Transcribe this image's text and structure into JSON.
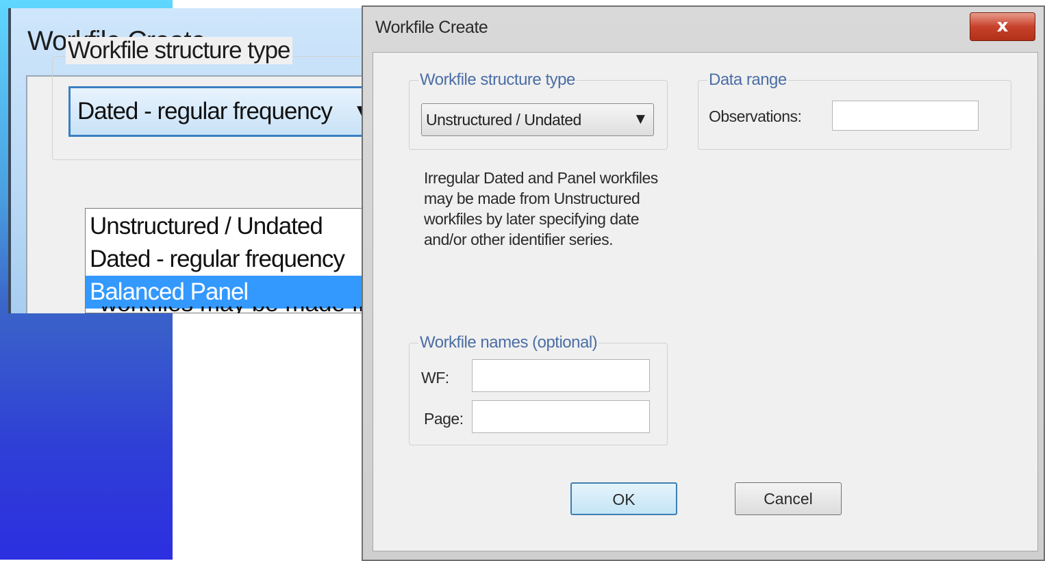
{
  "zoomed_view": {
    "window_title": "Workfile Create",
    "group_label": "Workfile structure type",
    "combo_value": "Dated - regular frequency",
    "dropdown_options": [
      {
        "label": "Unstructured / Undated",
        "selected": false
      },
      {
        "label": "Dated - regular frequency",
        "selected": false
      },
      {
        "label": "Balanced Panel",
        "selected": true
      }
    ],
    "partial_text": "workfiles may be made from"
  },
  "dialog": {
    "title": "Workfile Create",
    "close_label": "x",
    "structure_group": {
      "label": "Workfile structure type",
      "combo_value": "Unstructured / Undated"
    },
    "data_range": {
      "label": "Data range",
      "observations_label": "Observations:",
      "observations_value": ""
    },
    "note": "Irregular Dated and Panel workfiles may be made from Unstructured workfiles by later specifying date and/or other identifier series.",
    "names_group": {
      "label": "Workfile names (optional)",
      "wf_label": "WF:",
      "wf_value": "",
      "page_label": "Page:",
      "page_value": ""
    },
    "ok_label": "OK",
    "cancel_label": "Cancel"
  },
  "colors": {
    "selection": "#3399ff",
    "group_label": "#4b6ea5",
    "close_button": "#c8422c"
  }
}
